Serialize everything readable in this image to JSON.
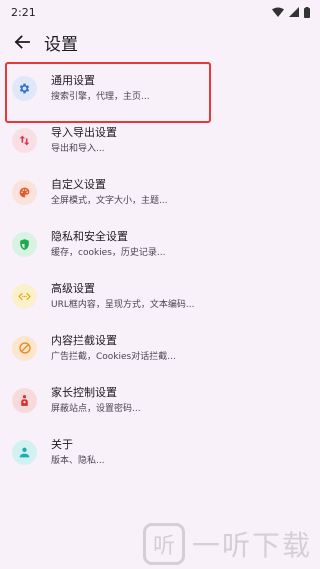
{
  "status_bar": {
    "time": "2:21"
  },
  "header": {
    "title": "设置"
  },
  "items": [
    {
      "title": "通用设置",
      "subtitle": "搜索引擎，代理，主页...",
      "icon": "gear-icon",
      "color": "#2f6fd6",
      "bg": "#dfe7f8"
    },
    {
      "title": "导入导出设置",
      "subtitle": "导出和导入...",
      "icon": "import-export-icon",
      "color": "#d43a58",
      "bg": "#f8dfe4"
    },
    {
      "title": "自定义设置",
      "subtitle": "全屏模式，文字大小，主题...",
      "icon": "palette-icon",
      "color": "#e25a2c",
      "bg": "#fae3da"
    },
    {
      "title": "隐私和安全设置",
      "subtitle": "缓存，cookies，历史记录...",
      "icon": "shield-icon",
      "color": "#1faa50",
      "bg": "#d9f2e1"
    },
    {
      "title": "高级设置",
      "subtitle": "URL框内容，呈现方式，文本编码...",
      "icon": "code-icon",
      "color": "#e2a600",
      "bg": "#fbf0cc"
    },
    {
      "title": "内容拦截设置",
      "subtitle": "广告拦截，Cookies对话拦截...",
      "icon": "block-icon",
      "color": "#f08a1e",
      "bg": "#fde6cf"
    },
    {
      "title": "家长控制设置",
      "subtitle": "屏蔽站点，设置密码...",
      "icon": "family-icon",
      "color": "#d92e2e",
      "bg": "#f9dada"
    },
    {
      "title": "关于",
      "subtitle": "版本、隐私...",
      "icon": "info-person-icon",
      "color": "#1ab0b0",
      "bg": "#d4f1f1"
    }
  ],
  "watermark": {
    "mark": "听",
    "text": "一听下载"
  }
}
